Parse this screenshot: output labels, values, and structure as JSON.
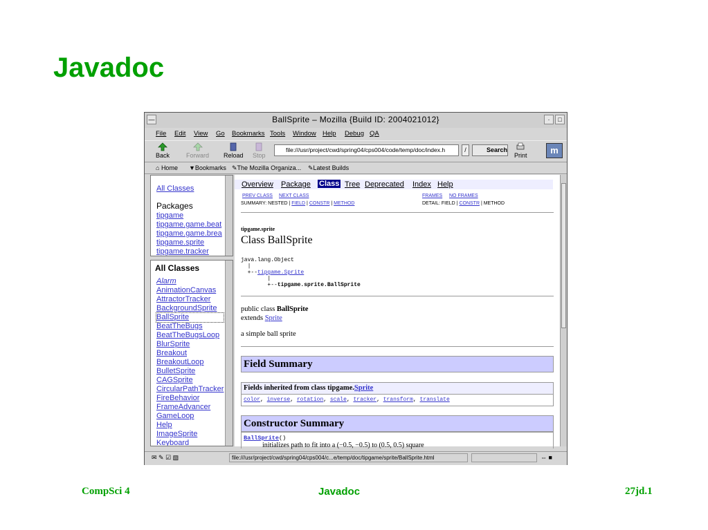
{
  "slide": {
    "title": "Javadoc",
    "footer_left": "CompSci 4",
    "footer_center": "Javadoc",
    "footer_right": "27jd.1"
  },
  "colors": {
    "accent_green": "#00a000",
    "javadoc_blue_bar": "#ccccff",
    "nav_selected": "#00008b"
  },
  "browser": {
    "window_title": "BallSprite – Mozilla {Build ID: 2004021012}",
    "menu": [
      "File",
      "Edit",
      "View",
      "Go",
      "Bookmarks",
      "Tools",
      "Window",
      "Help",
      "Debug",
      "QA"
    ],
    "nav": {
      "back": "Back",
      "forward": "Forward",
      "reload": "Reload",
      "stop": "Stop",
      "print": "Print",
      "search": "Search"
    },
    "url": "file:///usr/project/cwd/spring04/cps004/code/temp/doc/index.h",
    "personal": {
      "home": "Home",
      "bookmarks": "Bookmarks",
      "mozilla": "The Mozilla Organiza...",
      "latest": "Latest Builds"
    },
    "status_url": "file:///usr/project/cwd/spring04/cps004/c...e/temp/doc/tipgame/sprite/BallSprite.html"
  },
  "packages_frame": {
    "all_classes_link": "All Classes",
    "heading": "Packages",
    "items": [
      "tipgame",
      "tipgame.game.beat",
      "tipgame.game.brea",
      "tipgame.sprite",
      "tipgame.tracker"
    ]
  },
  "classes_frame": {
    "heading": "All Classes",
    "items": [
      "Alarm",
      "AnimationCanvas",
      "AttractorTracker",
      "BackgroundSprite",
      "BallSprite",
      "BeatTheBugs",
      "BeatTheBugsLoop",
      "BlurSprite",
      "Breakout",
      "BreakoutLoop",
      "BulletSprite",
      "CAGSprite",
      "CircularPathTracker",
      "FireBehavior",
      "FrameAdvancer",
      "GameLoop",
      "Help",
      "ImageSprite",
      "Keyboard"
    ]
  },
  "doc": {
    "nav": [
      "Overview",
      "Package",
      "Class",
      "Tree",
      "Deprecated",
      "Index",
      "Help"
    ],
    "prev_class": "PREV CLASS",
    "next_class": "NEXT CLASS",
    "frames": "FRAMES",
    "no_frames": "NO FRAMES",
    "summary_prefix": "SUMMARY: NESTED |",
    "summary_field": "FIELD",
    "summary_constr": "CONSTR",
    "summary_method": "METHOD",
    "detail_prefix": "DETAIL: FIELD |",
    "detail_constr": "CONSTR",
    "detail_method": "METHOD",
    "package_name": "tipgame.sprite",
    "class_title": "Class BallSprite",
    "hier_root": "java.lang.Object",
    "hier_mid": "tipgame.Sprite",
    "hier_leaf": "tipgame.sprite.BallSprite",
    "decl_prefix": "public class ",
    "decl_class": "BallSprite",
    "extends_word": "extends ",
    "extends_class": "Sprite",
    "description": "a simple ball sprite",
    "field_summary": "Field Summary",
    "inherited_label": "Fields inherited from class tipgame.",
    "inherited_class": "Sprite",
    "inherited_fields": [
      "color",
      "inverse",
      "rotation",
      "scale",
      "tracker",
      "transform",
      "translate"
    ],
    "constructor_summary": "Constructor Summary",
    "ctor_name": "BallSprite",
    "ctor_parens": "()",
    "ctor_desc": "initializes path to fit into a (−0.5, −0.5) to (0.5, 0.5) square"
  }
}
